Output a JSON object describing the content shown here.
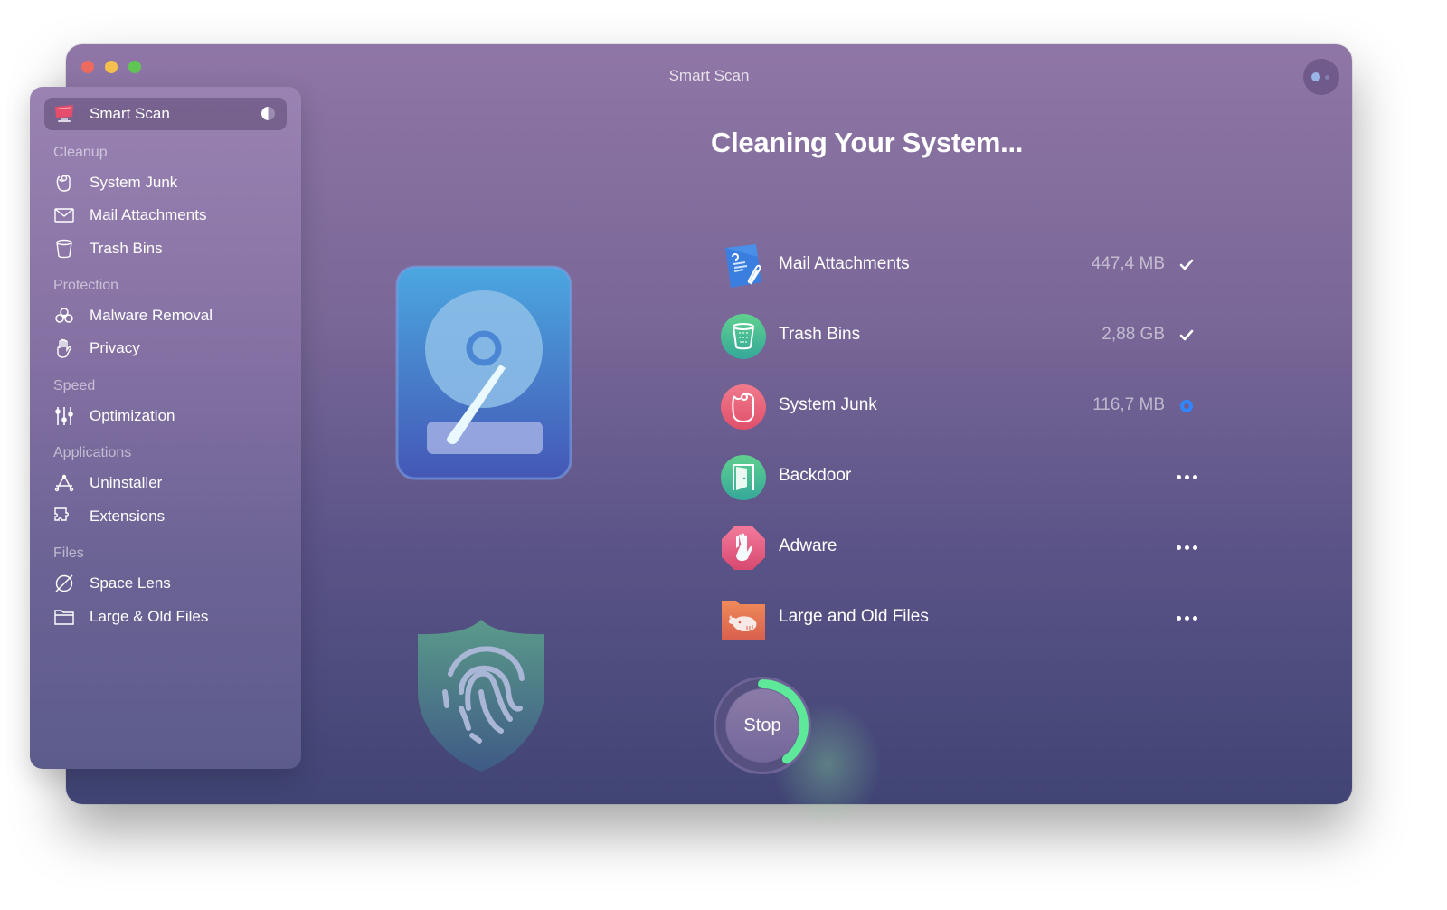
{
  "window": {
    "title": "Smart Scan"
  },
  "sidebar": {
    "active_item": {
      "label": "Smart Scan",
      "icon": "smart-scan-monitor-icon"
    },
    "sections": [
      {
        "title": "Cleanup",
        "items": [
          {
            "label": "System Junk",
            "icon": "system-junk-icon"
          },
          {
            "label": "Mail Attachments",
            "icon": "envelope-icon"
          },
          {
            "label": "Trash Bins",
            "icon": "trash-bin-icon"
          }
        ]
      },
      {
        "title": "Protection",
        "items": [
          {
            "label": "Malware Removal",
            "icon": "biohazard-icon"
          },
          {
            "label": "Privacy",
            "icon": "hand-icon"
          }
        ]
      },
      {
        "title": "Speed",
        "items": [
          {
            "label": "Optimization",
            "icon": "sliders-icon"
          }
        ]
      },
      {
        "title": "Applications",
        "items": [
          {
            "label": "Uninstaller",
            "icon": "app-store-a-icon"
          },
          {
            "label": "Extensions",
            "icon": "puzzle-icon"
          }
        ]
      },
      {
        "title": "Files",
        "items": [
          {
            "label": "Space Lens",
            "icon": "planet-lens-icon"
          },
          {
            "label": "Large & Old Files",
            "icon": "folder-icon"
          }
        ]
      }
    ]
  },
  "main": {
    "heading": "Cleaning Your System...",
    "tasks": [
      {
        "name": "Mail Attachments",
        "size": "447,4 MB",
        "status": "done",
        "icon": "mail-attachment-icon",
        "color": "#3a7ee0"
      },
      {
        "name": "Trash Bins",
        "size": "2,88 GB",
        "status": "done",
        "icon": "trash-bin-icon",
        "color": "#3bb38a"
      },
      {
        "name": "System Junk",
        "size": "116,7 MB",
        "status": "in-progress",
        "icon": "system-junk-icon",
        "color": "#e85a74"
      },
      {
        "name": "Backdoor",
        "size": "",
        "status": "pending",
        "icon": "door-icon",
        "color": "#3bb38a"
      },
      {
        "name": "Adware",
        "size": "",
        "status": "pending",
        "icon": "stop-hand-icon",
        "color": "#e05a80"
      },
      {
        "name": "Large and Old Files",
        "size": "",
        "status": "pending",
        "icon": "whale-folder-icon",
        "color": "#e8744e"
      }
    ],
    "stop_button": {
      "label": "Stop",
      "progress_percent": 40,
      "progress_color": "#5ee89a"
    }
  },
  "colors": {
    "accent_blue": "#2f86ff",
    "progress_green": "#5ee89a"
  }
}
